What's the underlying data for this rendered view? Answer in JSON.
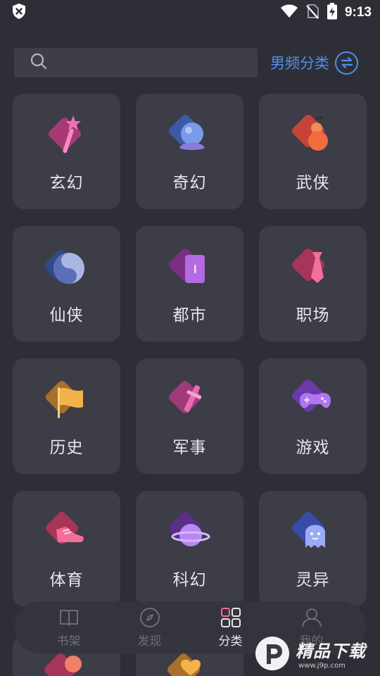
{
  "status_bar": {
    "time": "9:13",
    "icons": [
      "shield-x-icon",
      "wifi-icon",
      "no-sim-icon",
      "battery-charging-icon"
    ]
  },
  "header": {
    "search_placeholder": "",
    "gender_label": "男频分类",
    "swap_icon": "swap-icon"
  },
  "categories": [
    {
      "label": "玄幻",
      "icon": "magic-wand-icon"
    },
    {
      "label": "奇幻",
      "icon": "crystal-ball-icon"
    },
    {
      "label": "武侠",
      "icon": "gourd-icon"
    },
    {
      "label": "仙侠",
      "icon": "yin-yang-icon"
    },
    {
      "label": "都市",
      "icon": "phone-icon"
    },
    {
      "label": "职场",
      "icon": "necktie-icon"
    },
    {
      "label": "历史",
      "icon": "flag-icon"
    },
    {
      "label": "军事",
      "icon": "sword-icon"
    },
    {
      "label": "游戏",
      "icon": "gamepad-icon"
    },
    {
      "label": "体育",
      "icon": "sneaker-icon"
    },
    {
      "label": "科幻",
      "icon": "planet-icon"
    },
    {
      "label": "灵异",
      "icon": "ghost-icon"
    }
  ],
  "bottom_nav": [
    {
      "label": "书架",
      "icon": "book-icon",
      "active": false
    },
    {
      "label": "发现",
      "icon": "compass-icon",
      "active": false
    },
    {
      "label": "分类",
      "icon": "category-grid-icon",
      "active": true
    },
    {
      "label": "我的",
      "icon": "user-icon",
      "active": false
    }
  ],
  "watermark": {
    "title": "精品下载",
    "url": "www.j9p.com"
  },
  "colors": {
    "background": "#2e2f36",
    "card": "#3c3d46",
    "accent": "#4c8ff0",
    "text": "#e6e6ea",
    "muted": "#6c6d75"
  }
}
